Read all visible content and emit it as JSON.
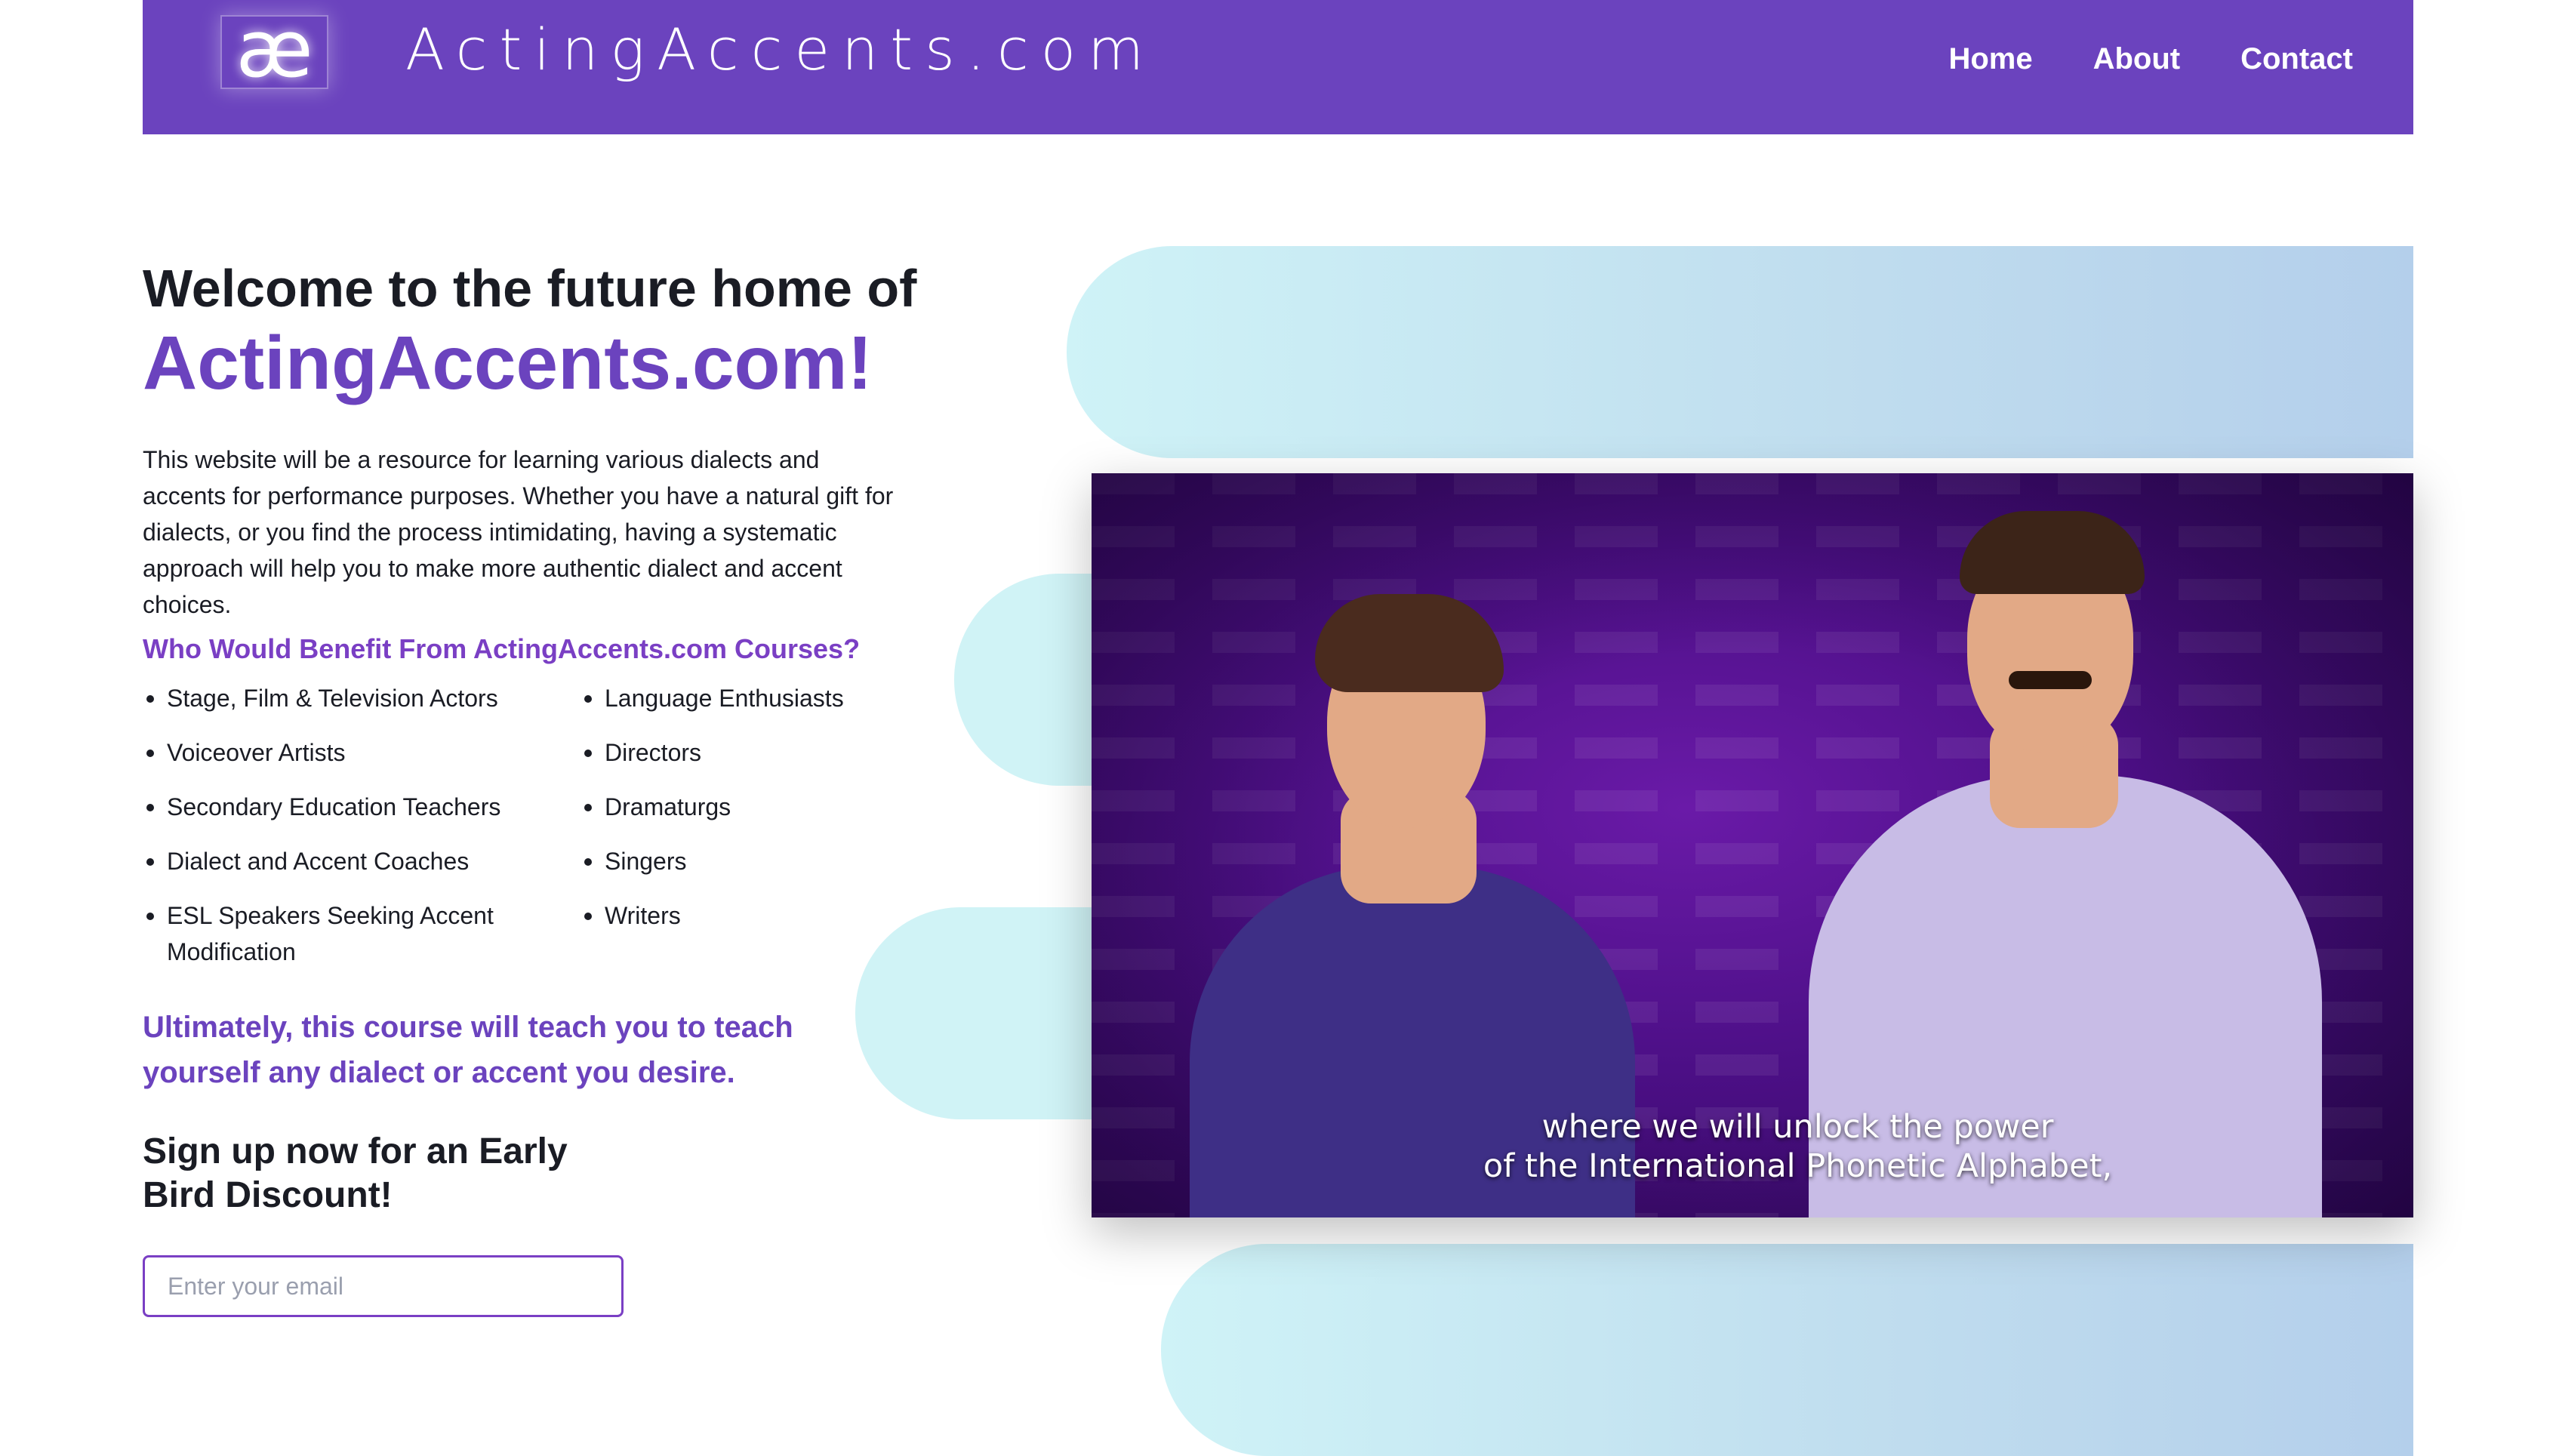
{
  "header": {
    "logo_glyph": "æ",
    "wordmark": "ActingAccents.com",
    "nav": [
      "Home",
      "About",
      "Contact"
    ]
  },
  "hero": {
    "welcome_line": "Welcome to the future home of",
    "brand_line": "ActingAccents.com!",
    "intro": "This website will be a resource for learning various dialects and accents for performance purposes. Whether you have a natural gift for dialects, or you find the process intimidating, having a systematic approach will help you to make more authentic dialect and accent choices.",
    "who_heading": "Who Would Benefit From ActingAccents.com Courses?",
    "benefits_col1": [
      "Stage, Film & Television Actors",
      "Voiceover Artists",
      "Secondary Education Teachers",
      "Dialect and Accent Coaches",
      "ESL Speakers Seeking Accent Modification"
    ],
    "benefits_col2": [
      "Language Enthusiasts",
      "Directors",
      "Dramaturgs",
      "Singers",
      "Writers"
    ],
    "ultimately": "Ultimately, this course will teach you to teach yourself any dialect or accent you desire.",
    "signup_heading": "Sign up now for an Early Bird Discount!",
    "email_placeholder": "Enter your email"
  },
  "video": {
    "caption_line1": "where we will unlock the power",
    "caption_line2": "of the International Phonetic Alphabet,"
  },
  "colors": {
    "brand_purple": "#6b43be",
    "heading_purple": "#7a3fc4",
    "pill_cyan": "#d0f3f6",
    "pill_blue": "#b4cfeb"
  }
}
